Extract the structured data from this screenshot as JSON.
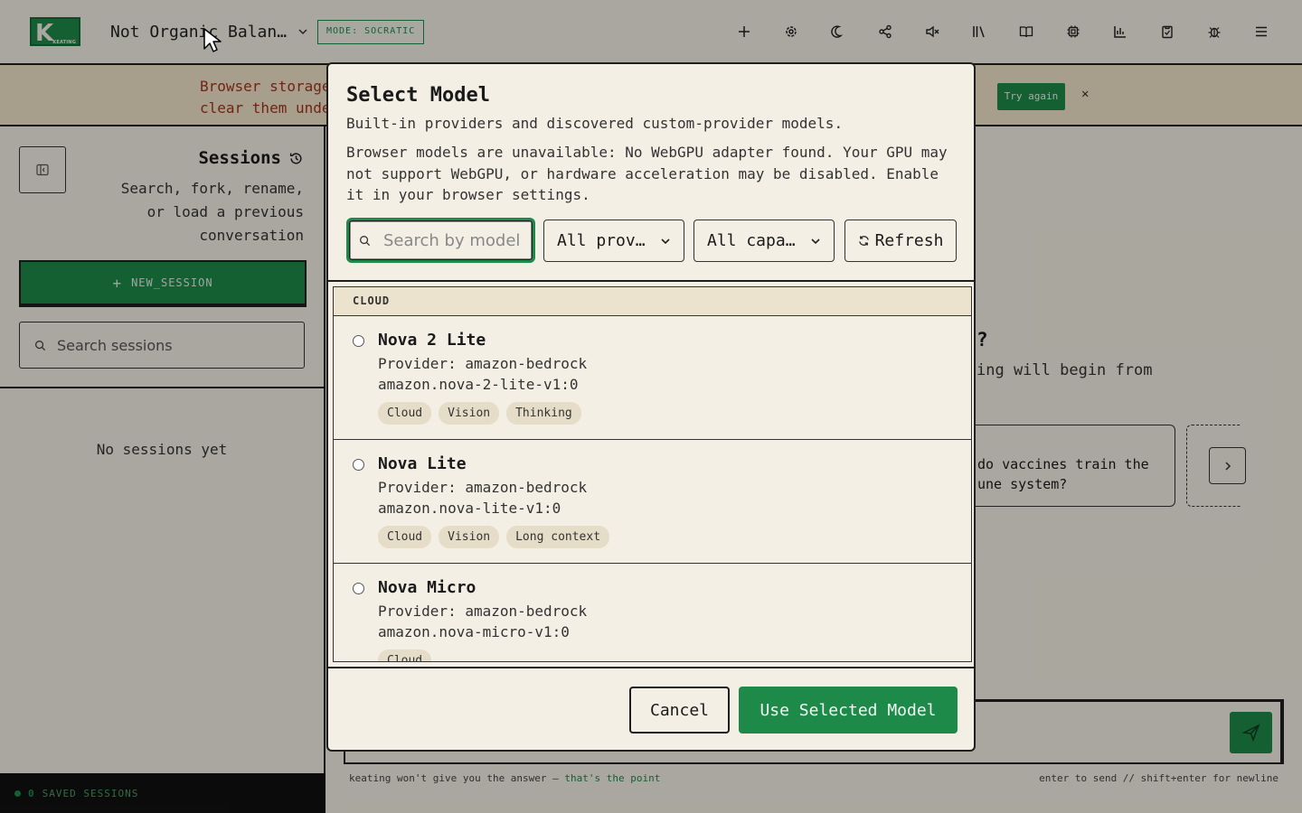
{
  "header": {
    "logo_letter": "K",
    "logo_small": "KEATING",
    "conversation_title": "Not Organic Balan…",
    "mode_badge": "MODE: SOCRATIC",
    "icons": [
      "plus-icon",
      "settings-icon",
      "moon-icon",
      "share-icon",
      "mute-icon",
      "library-icon",
      "book-icon",
      "chip-icon",
      "chart-icon",
      "clipboard-icon",
      "bug-icon",
      "menu-icon"
    ]
  },
  "banner": {
    "text_line1": "Browser storage",
    "text_line2": "clear them unde",
    "try_again": "Try again",
    "close": "✕"
  },
  "sidebar": {
    "title": "Sessions",
    "description": "Search, fork, rename, or load a previous conversation",
    "new_session": "NEW_SESSION",
    "search_placeholder": "Search sessions",
    "empty_text": "No sessions yet",
    "footer_count": "0",
    "footer_label": "SAVED SESSIONS"
  },
  "main": {
    "question_fragment": "?",
    "subtitle_fragment": "ing will begin from",
    "suggestion_line1": "do vaccines train the",
    "suggestion_line2": "une system?",
    "hint_left_prefix": "keating won't give you the answer — ",
    "hint_left_green": "that's the point",
    "hint_right": "enter to send // shift+enter for newline"
  },
  "modal": {
    "title": "Select Model",
    "subtitle": "Built-in providers and discovered custom-provider models.",
    "warning": "Browser models are unavailable: No WebGPU adapter found. Your GPU may not support WebGPU, or hardware acceleration may be disabled. Enable it in your browser settings.",
    "search_placeholder": "Search by model, provider, or ID",
    "provider_filter": "All prov…",
    "capability_filter": "All capa…",
    "refresh": "Refresh",
    "group_label": "CLOUD",
    "models": [
      {
        "name": "Nova 2 Lite",
        "provider": "Provider: amazon-bedrock",
        "id": "amazon.nova-2-lite-v1:0",
        "tags": [
          "Cloud",
          "Vision",
          "Thinking"
        ]
      },
      {
        "name": "Nova Lite",
        "provider": "Provider: amazon-bedrock",
        "id": "amazon.nova-lite-v1:0",
        "tags": [
          "Cloud",
          "Vision",
          "Long context"
        ]
      },
      {
        "name": "Nova Micro",
        "provider": "Provider: amazon-bedrock",
        "id": "amazon.nova-micro-v1:0",
        "tags": [
          "Cloud"
        ]
      }
    ],
    "cancel": "Cancel",
    "use_selected": "Use Selected Model"
  },
  "colors": {
    "accent": "#1d8a4a",
    "background": "#f3efe4",
    "warning_text": "#a0361c"
  }
}
